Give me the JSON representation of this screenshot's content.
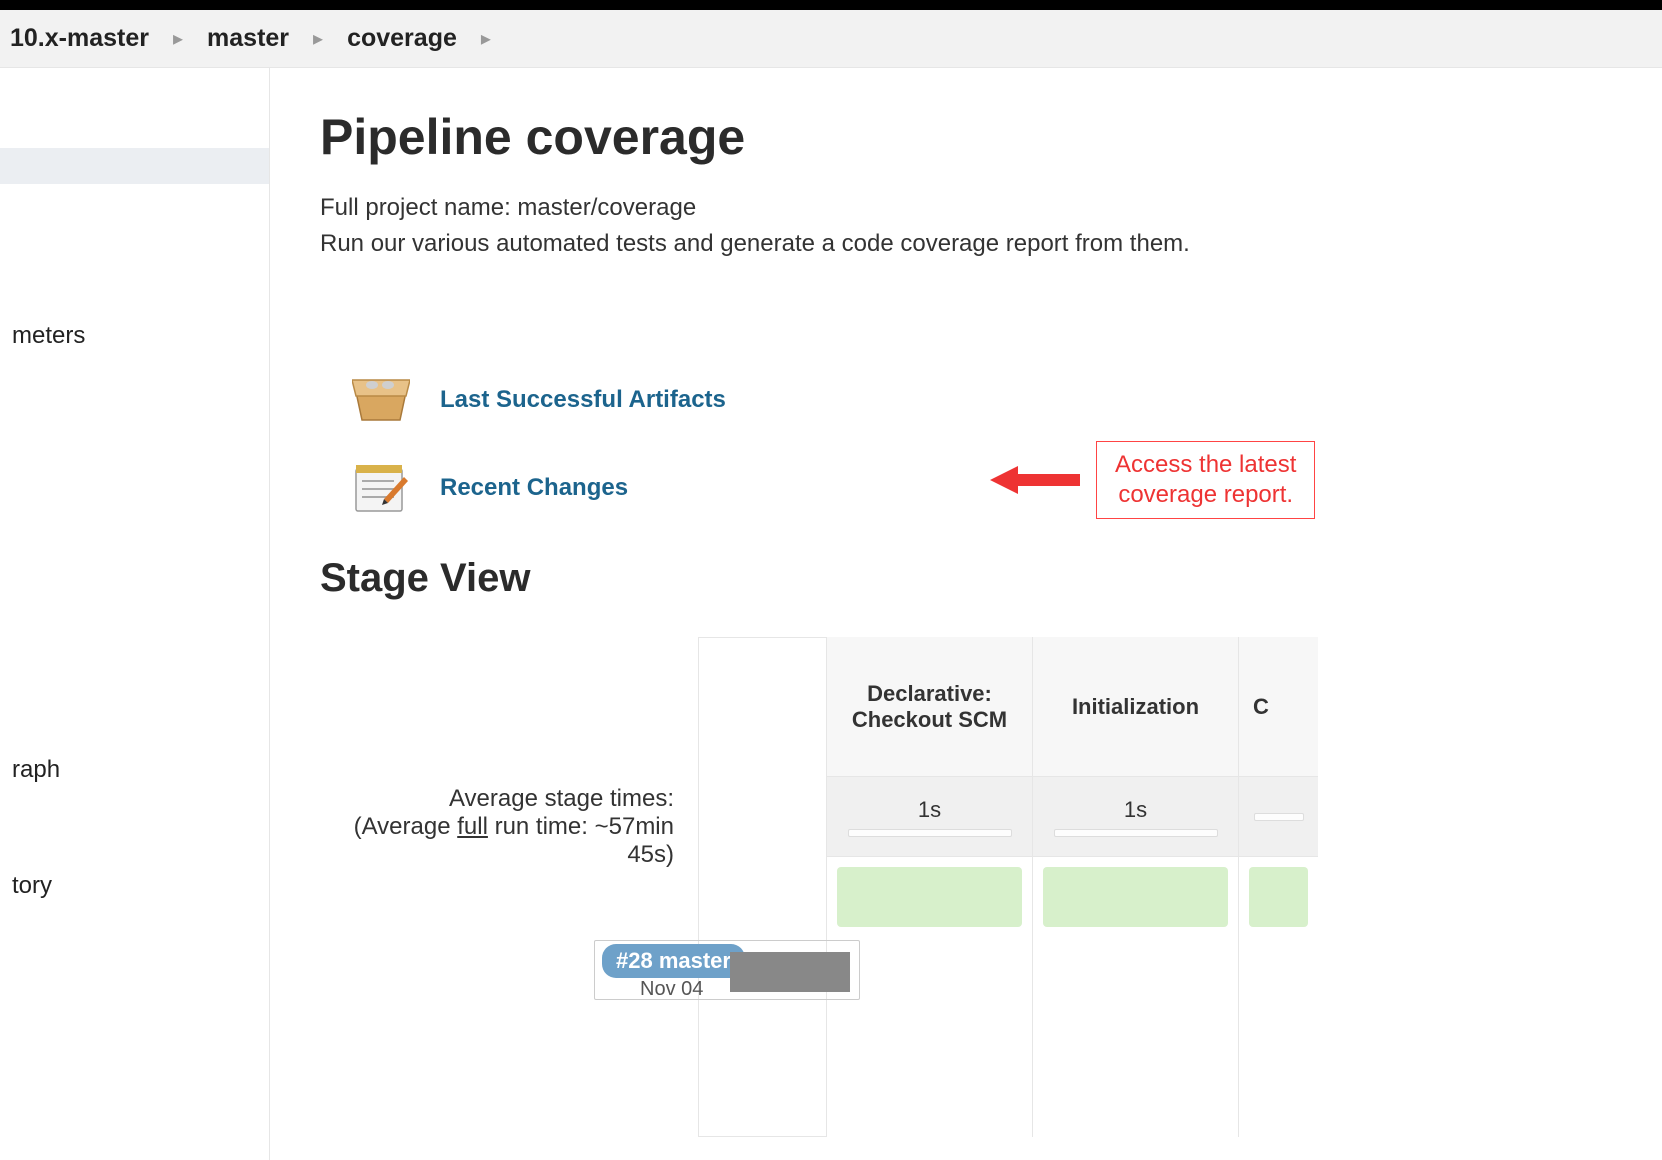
{
  "breadcrumb": {
    "items": [
      "10.x-master",
      "master",
      "coverage"
    ]
  },
  "sidebar": {
    "items": [
      "",
      "meters",
      "raph",
      "tory"
    ]
  },
  "page": {
    "title": "Pipeline coverage",
    "full_project_label": "Full project name: master/coverage",
    "description": "Run our various automated tests and generate a code coverage report from them."
  },
  "links": {
    "artifacts": "Last Successful Artifacts",
    "changes": "Recent Changes"
  },
  "annotation": {
    "text_line1": "Access the latest",
    "text_line2": "coverage report."
  },
  "stage_view": {
    "title": "Stage View",
    "avg_label": "Average stage times:",
    "avg_sub_prefix": "(Average ",
    "avg_sub_underline": "full",
    "avg_sub_suffix": " run time: ~57min",
    "avg_sub_line2": "45s)",
    "columns": [
      {
        "name": "Declarative: Checkout SCM",
        "avg": "1s"
      },
      {
        "name": "Initialization",
        "avg": "1s"
      },
      {
        "name": "C",
        "avg": ""
      }
    ],
    "build": {
      "pill": "#28 master",
      "date": "Nov 04"
    }
  }
}
